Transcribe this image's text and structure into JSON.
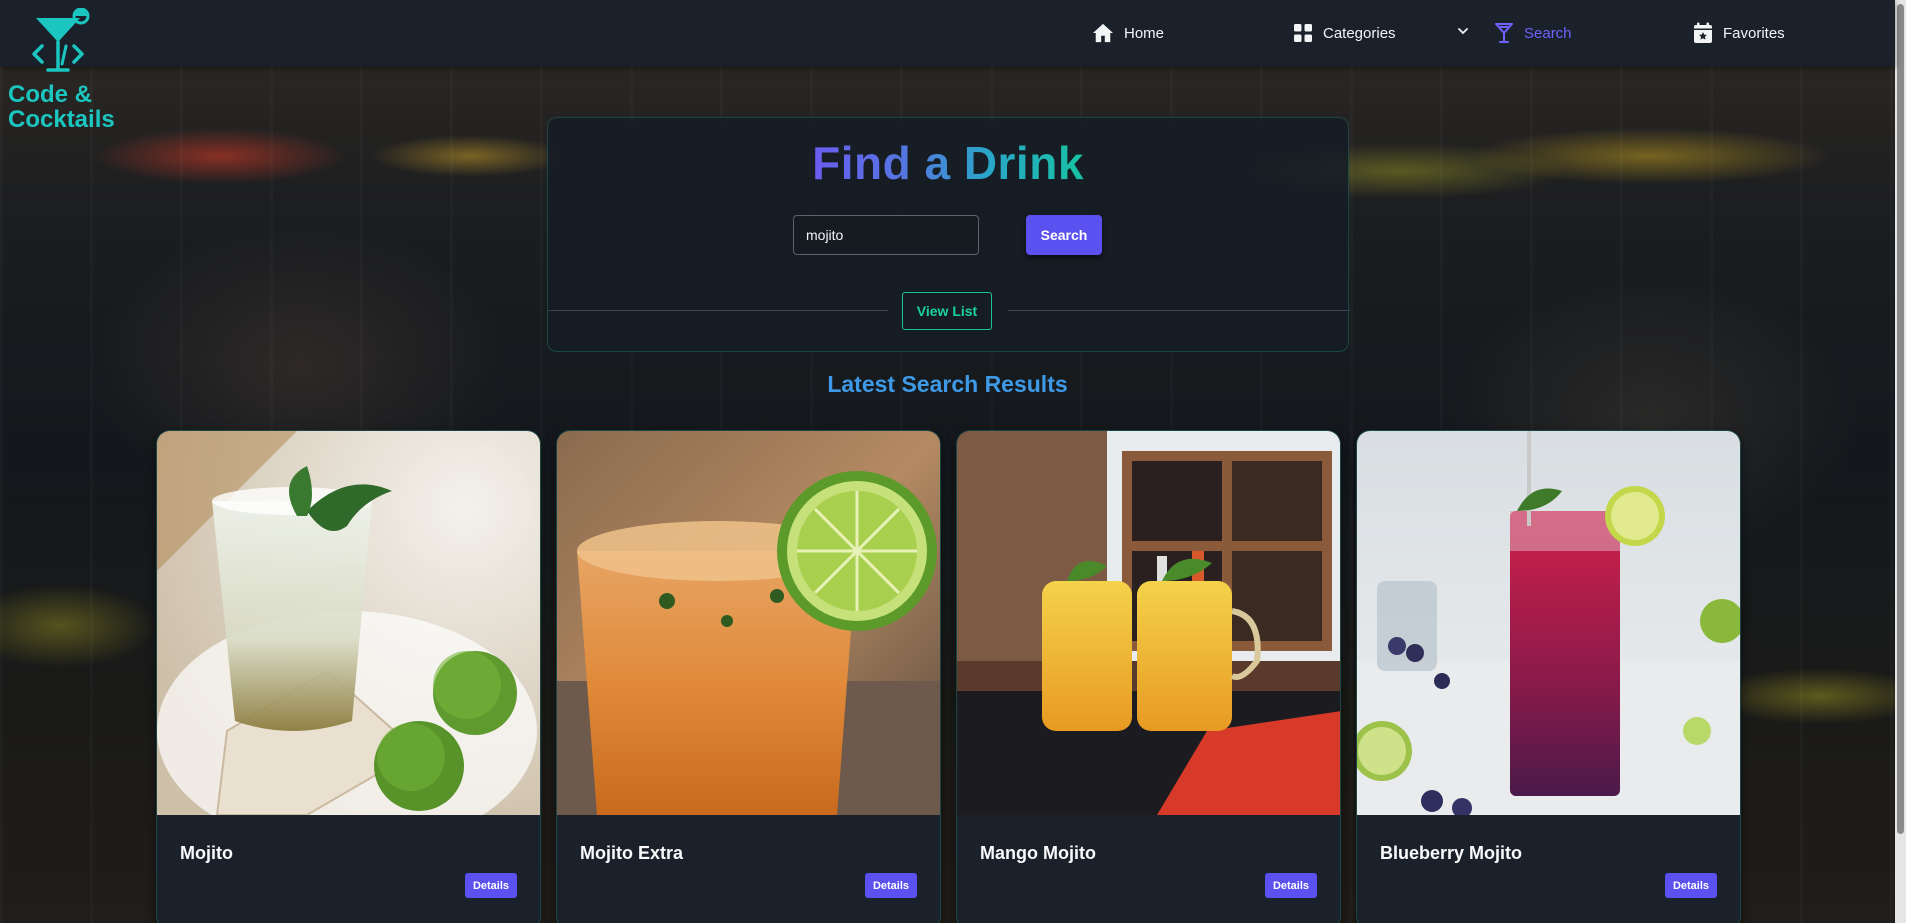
{
  "logo": {
    "line1": "Code &",
    "line2": "Cocktails"
  },
  "nav": {
    "home": "Home",
    "categories": "Categories",
    "search": "Search",
    "favorites": "Favorites",
    "active": "search"
  },
  "search_panel": {
    "title": "Find a Drink",
    "query": "mojito",
    "search_button": "Search",
    "view_list_button": "View List"
  },
  "results": {
    "heading": "Latest Search Results",
    "cards": [
      {
        "name": "Mojito",
        "details_label": "Details",
        "image": "mojito-glass-with-mint-and-limes"
      },
      {
        "name": "Mojito Extra",
        "details_label": "Details",
        "image": "orange-drink-with-lime-wheel"
      },
      {
        "name": "Mango Mojito",
        "details_label": "Details",
        "image": "two-mango-mojito-mason-jars"
      },
      {
        "name": "Blueberry Mojito",
        "details_label": "Details",
        "image": "purple-blueberry-mojito-tall-glass"
      }
    ]
  },
  "colors": {
    "accent": "#5b50f0",
    "teal": "#1cc6c0",
    "heading_blue": "#3e9ae6",
    "navbar": "#1a212b"
  }
}
